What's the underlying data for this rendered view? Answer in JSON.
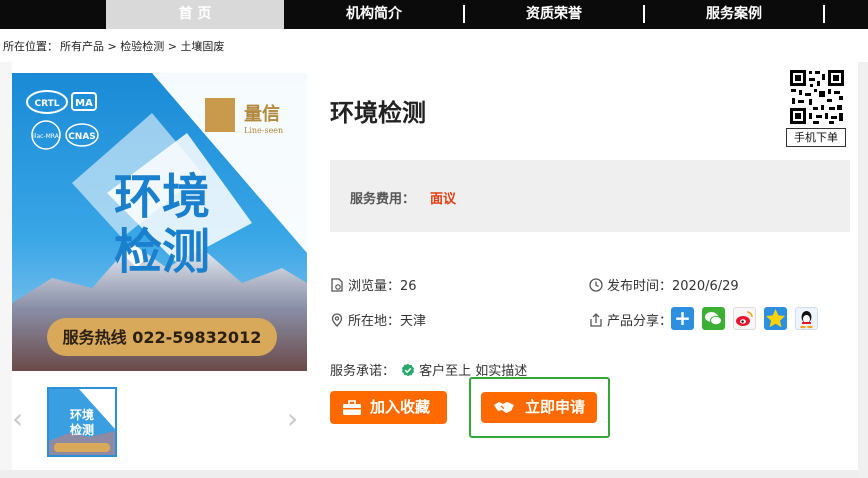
{
  "nav": {
    "items": [
      {
        "label": "首 页",
        "active": true
      },
      {
        "label": "机构简介",
        "active": false
      },
      {
        "label": "资质荣誉",
        "active": false
      },
      {
        "label": "服务案例",
        "active": false
      }
    ]
  },
  "breadcrumb": {
    "prefix": "所在位置：",
    "path": [
      "所有产品",
      "检验检测",
      "土壤固废"
    ],
    "separator": " > "
  },
  "product": {
    "title": "环境检测",
    "image": {
      "badges": [
        "CRTL",
        "MA",
        "ilac-MRA",
        "CNAS"
      ],
      "brand": "量信",
      "brand_en": "Line-seen",
      "headline_line1": "环境",
      "headline_line2": "检测",
      "hotline": "服务热线 022-59832012"
    },
    "thumbnail": {
      "headline_line1": "环境",
      "headline_line2": "检测"
    },
    "qr_label": "手机下单",
    "price_label": "服务费用：",
    "price_value": "面议",
    "views_label": "浏览量：",
    "views_value": "26",
    "publish_label": "发布时间：",
    "publish_value": "2020/6/29",
    "location_label": "所在地：",
    "location_value": "天津",
    "share_label": "产品分享：",
    "share_icons": [
      "plus-share-icon",
      "wechat-icon",
      "weibo-icon",
      "qzone-icon",
      "qq-icon"
    ],
    "promise_label": "服务承诺：",
    "promise_value": "客户至上 如实描述",
    "favorite_button": "加入收藏",
    "apply_button": "立即申请"
  },
  "colors": {
    "accent_orange": "#ff6a00",
    "price_red": "#e33d12",
    "nav_bg": "#0b0b0b",
    "highlight_green": "#35a63a"
  }
}
